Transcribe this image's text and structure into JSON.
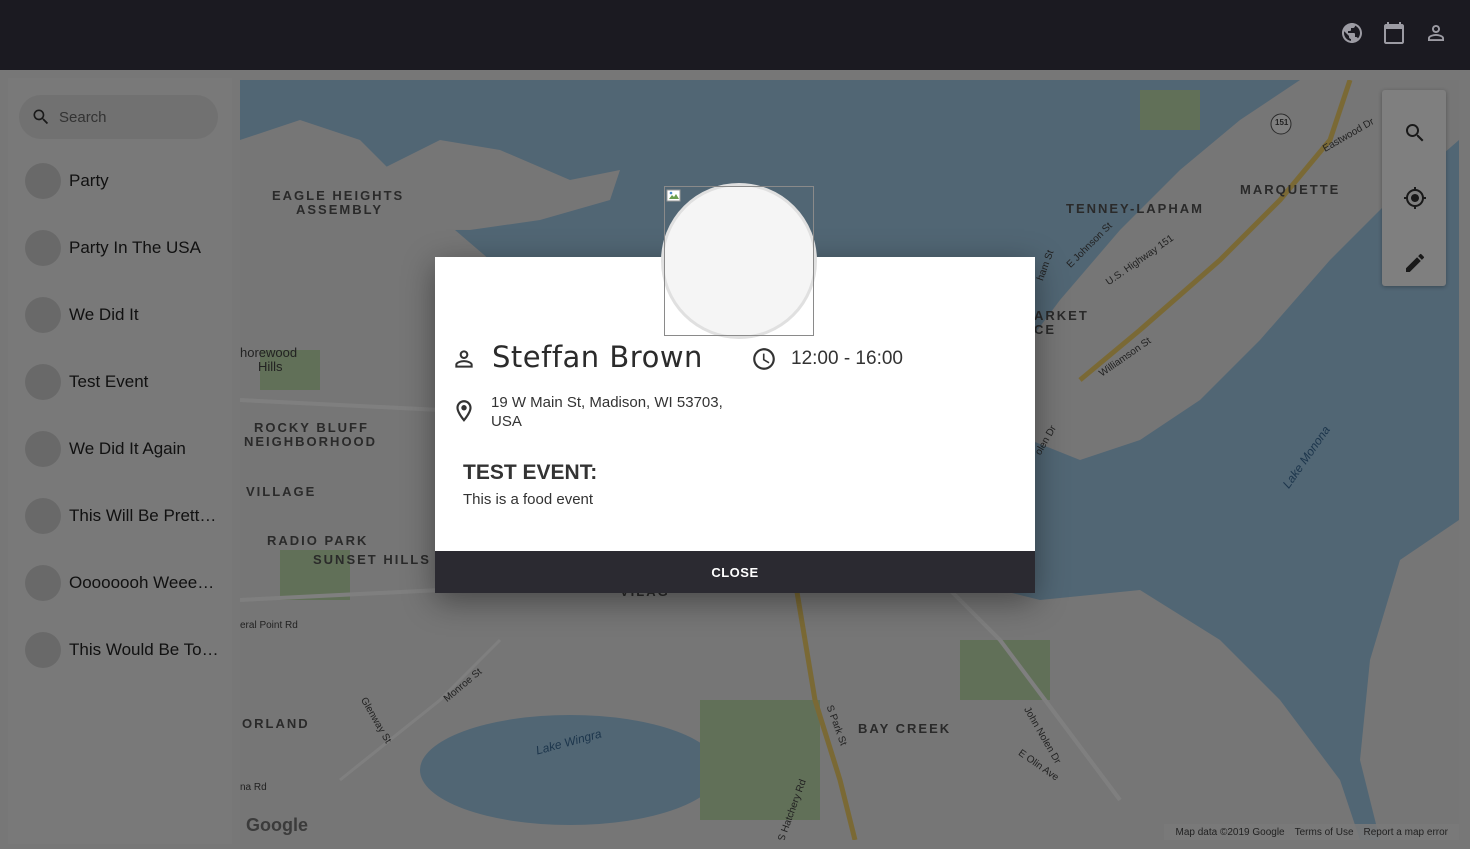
{
  "topbar": {
    "icons": [
      "globe-icon",
      "calendar-icon",
      "person-icon"
    ]
  },
  "sidebar": {
    "search_placeholder": "Search",
    "events": [
      {
        "label": "Party"
      },
      {
        "label": "Party In The USA"
      },
      {
        "label": "We Did It"
      },
      {
        "label": "Test Event"
      },
      {
        "label": "We Did It Again"
      },
      {
        "label": "This Will Be Pretty ..."
      },
      {
        "label": "Oooooooh Weeeeee"
      },
      {
        "label": "This Would Be Too..."
      }
    ]
  },
  "map": {
    "areas": [
      "EAGLE HEIGHTS",
      "ASSEMBLY",
      "TENNEY-LAPHAM",
      "MARQUETTE",
      "ROCKY BLUFF",
      "NEIGHBORHOOD",
      "VILLAGE",
      "RADIO PARK",
      "SUNSET HILLS",
      "ORLAND",
      "BAY CREEK",
      "horewood",
      "Hills",
      "ARKET",
      "CE",
      "VILAG"
    ],
    "streets": [
      "U.S. Highway 151",
      "Williamson St",
      "Eastwood Dr",
      "E Johnson St",
      "Monroe St",
      "Glenway St",
      "S Park St",
      "John Nolen Dr",
      "E Olin Ave",
      "S Hatchery Rd",
      "eral Point Rd",
      "na Rd",
      "olen Dr",
      "ham St"
    ],
    "water": [
      "Lake Monona",
      "Lake Wingra"
    ],
    "highway_shield": "151",
    "attribution": [
      "Map data ©2019 Google",
      "Terms of Use",
      "Report a map error"
    ],
    "logo": "Google",
    "tools": [
      "search-icon",
      "locate-icon",
      "pencil-icon"
    ]
  },
  "dialog": {
    "host_name": "Steffan Brown",
    "time": "12:00 - 16:00",
    "address": "19 W Main St, Madison, WI 53703, USA",
    "event_title": "TEST EVENT:",
    "event_description": "This is a food event",
    "close_label": "CLOSE"
  }
}
